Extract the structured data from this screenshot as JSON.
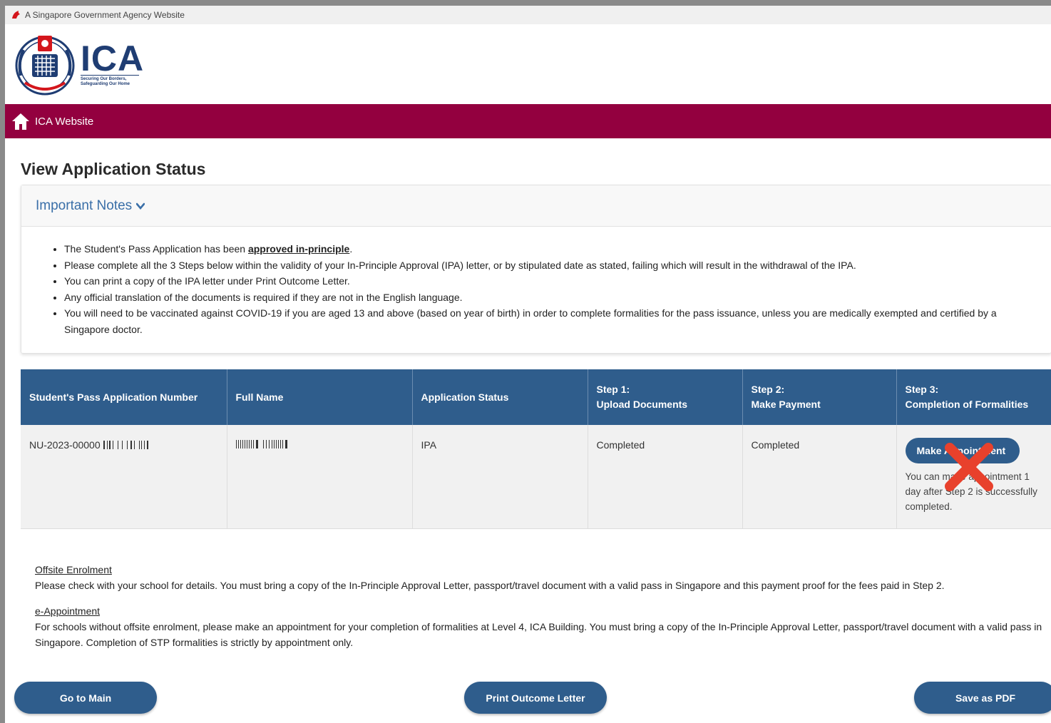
{
  "gov_banner": "A Singapore Government Agency Website",
  "logo": {
    "name": "ICA",
    "tagline_1": "Securing Our Borders,",
    "tagline_2": "Safeguarding Our Home"
  },
  "nav": {
    "home_label": "ICA Website"
  },
  "page": {
    "title": "View Application Status"
  },
  "notes": {
    "header": "Important Notes",
    "items": [
      {
        "pre": "The Student's Pass Application has been ",
        "bold": "approved in-principle",
        "post": "."
      },
      {
        "pre": "Please complete all the 3 Steps below within the validity of your In-Principle Approval (IPA) letter, or by stipulated date as stated, failing which will result in the withdrawal of the IPA.",
        "bold": "",
        "post": ""
      },
      {
        "pre": "You can print a copy of the IPA letter under Print Outcome Letter.",
        "bold": "",
        "post": ""
      },
      {
        "pre": "Any official translation of the documents is required if they are not in the English language.",
        "bold": "",
        "post": ""
      },
      {
        "pre": "You will need to be vaccinated against COVID-19 if you are aged 13 and above (based on year of birth) in order to complete formalities for the pass issuance, unless you are medically exempted and certified by a Singapore doctor.",
        "bold": "",
        "post": ""
      }
    ]
  },
  "table": {
    "headers": [
      {
        "line1": "",
        "line2": "Student's Pass Application Number"
      },
      {
        "line1": "",
        "line2": "Full Name"
      },
      {
        "line1": "",
        "line2": "Application Status"
      },
      {
        "line1": "Step 1:",
        "line2": "Upload Documents"
      },
      {
        "line1": "Step 2:",
        "line2": "Make Payment"
      },
      {
        "line1": "Step 3:",
        "line2": "Completion of Formalities"
      }
    ],
    "row": {
      "app_number": "NU-2023-00000",
      "status": "IPA",
      "step1": "Completed",
      "step2": "Completed",
      "appointment_button": "Make Appointment",
      "appointment_note": "You can make appointment 1 day after Step 2 is successfully completed."
    }
  },
  "info": {
    "offsite_heading": "Offsite Enrolment",
    "offsite_text": "Please check with your school for details. You must bring a copy of the In-Principle Approval Letter, passport/travel document with a valid pass in Singapore and this payment proof for the fees paid in Step 2.",
    "eappt_heading": "e-Appointment",
    "eappt_text": "For schools without offsite enrolment, please make an appointment for your completion of formalities at Level 4, ICA Building. You must bring a copy of the In-Principle Approval Letter, passport/travel document with a valid pass in Singapore. Completion of STP formalities is strictly by appointment only."
  },
  "actions": {
    "main": "Go to Main",
    "print": "Print Outcome Letter",
    "pdf": "Save as PDF"
  },
  "colors": {
    "nav_bg": "#93003f",
    "table_header": "#2f5d8c",
    "button": "#2f5d8c",
    "link": "#3a6fa8",
    "x_mark": "#e8412c"
  }
}
